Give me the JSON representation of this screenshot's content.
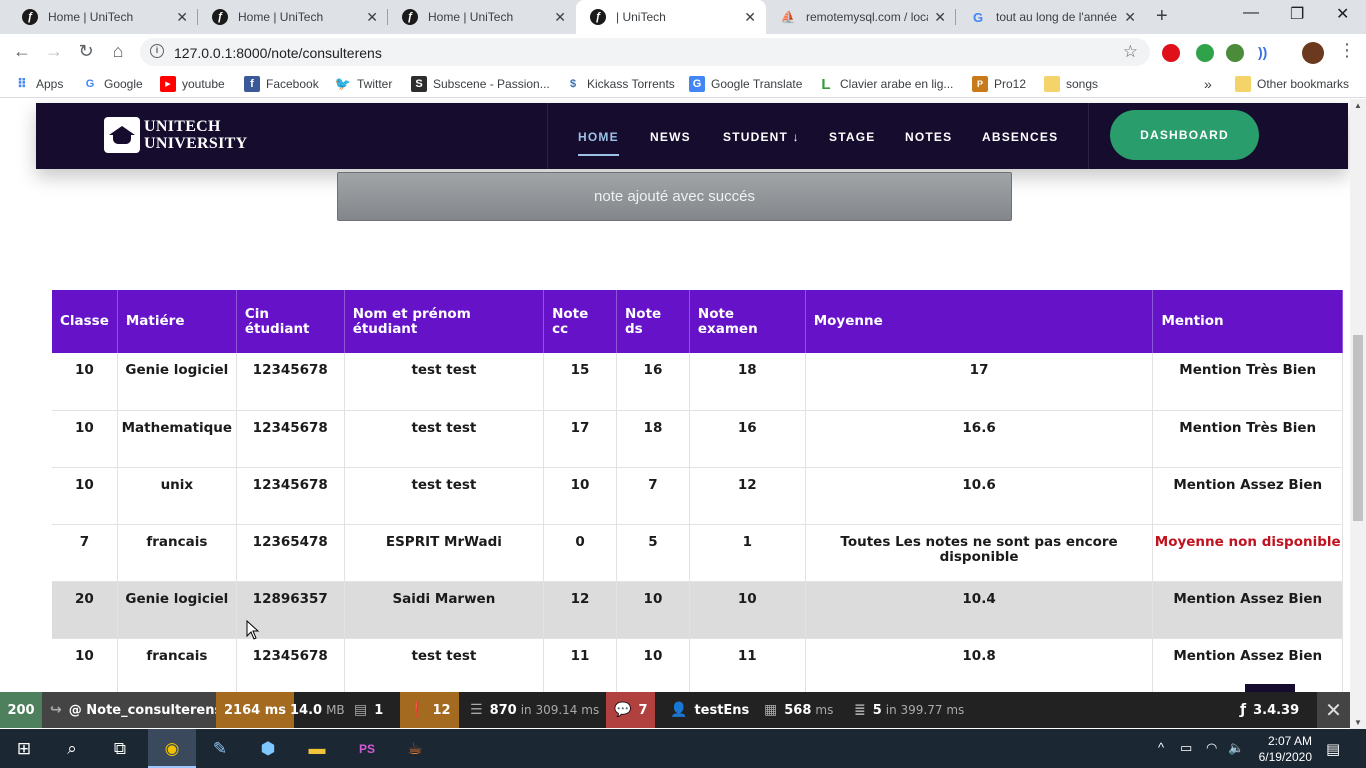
{
  "browser": {
    "tabs": [
      {
        "title": "Home | UniTech",
        "icon": "symfony-icon"
      },
      {
        "title": "Home | UniTech",
        "icon": "symfony-icon"
      },
      {
        "title": "Home | UniTech",
        "icon": "symfony-icon"
      },
      {
        "title": "| UniTech",
        "icon": "symfony-icon",
        "active": true
      },
      {
        "title": "remotemysql.com / loca",
        "icon": "phpmyadmin-icon"
      },
      {
        "title": "tout au long de l'année",
        "icon": "google-icon"
      }
    ],
    "url": "127.0.0.1:8000/note/consulterens",
    "bookmarks": [
      "Apps",
      "Google",
      "youtube",
      "Facebook",
      "Twitter",
      "Subscene - Passion...",
      "Kickass Torrents",
      "Google Translate",
      "Clavier arabe en lig...",
      "Pro12",
      "songs"
    ],
    "other_bookmarks": "Other bookmarks"
  },
  "site": {
    "logo_line1": "UNITECH",
    "logo_line2": "UNIVERSITY",
    "nav": [
      "HOME",
      "NEWS",
      "STUDENT ↓",
      "STAGE",
      "NOTES",
      "ABSENCES"
    ],
    "dashboard": "DASHBOARD",
    "flash": "note ajouté avec succés"
  },
  "table": {
    "headers": [
      "Classe",
      "Matiére",
      "Cin étudiant",
      "Nom et prénom étudiant",
      "Note cc",
      "Note ds",
      "Note examen",
      "Moyenne",
      "Mention"
    ],
    "rows": [
      [
        "10",
        "Genie logiciel",
        "12345678",
        "test test",
        "15",
        "16",
        "18",
        "17",
        "Mention Très Bien"
      ],
      [
        "10",
        "Mathematique",
        "12345678",
        "test test",
        "17",
        "18",
        "16",
        "16.6",
        "Mention Très Bien"
      ],
      [
        "10",
        "unix",
        "12345678",
        "test test",
        "10",
        "7",
        "12",
        "10.6",
        "Mention Assez Bien"
      ],
      [
        "7",
        "francais",
        "12365478",
        "ESPRIT MrWadi",
        "0",
        "5",
        "1",
        "Toutes Les notes ne sont pas encore disponible",
        "Moyenne non disponible"
      ],
      [
        "20",
        "Genie logiciel",
        "12896357",
        "Saidi Marwen",
        "12",
        "10",
        "10",
        "10.4",
        "Mention Assez Bien"
      ],
      [
        "10",
        "francais",
        "12345678",
        "test test",
        "11",
        "10",
        "11",
        "10.8",
        "Mention Assez Bien"
      ]
    ]
  },
  "profiler": {
    "status": "200",
    "route": "@ Note_consulterens",
    "time": "2164 ms",
    "memory": "14.0",
    "memory_unit": "MB",
    "forms": "1",
    "logs": "12",
    "cache": "870",
    "cache_detail": "in 309.14 ms",
    "translations": "7",
    "user": "testEns",
    "twig": "568",
    "twig_unit": "ms",
    "db": "5",
    "db_detail": "in 399.77 ms",
    "version": "3.4.39"
  },
  "taskbar": {
    "time": "2:07 AM",
    "date": "6/19/2020"
  }
}
